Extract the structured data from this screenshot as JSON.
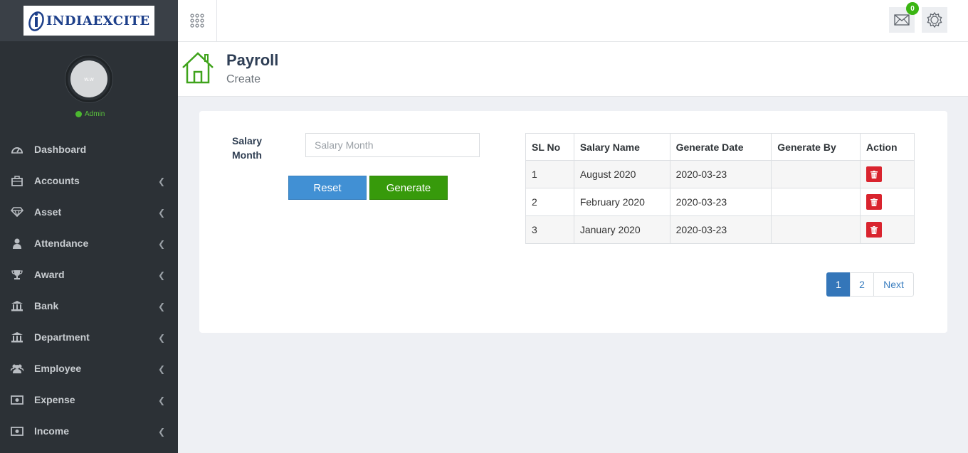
{
  "brand": {
    "name": "INDIAEXCITE"
  },
  "sidebar": {
    "avatar_text": "w.w",
    "role": "Admin",
    "items": [
      {
        "label": "Dashboard",
        "icon": "dashboard-icon",
        "has_submenu": false
      },
      {
        "label": "Accounts",
        "icon": "briefcase-icon",
        "has_submenu": true
      },
      {
        "label": "Asset",
        "icon": "diamond-icon",
        "has_submenu": true
      },
      {
        "label": "Attendance",
        "icon": "user-icon",
        "has_submenu": true
      },
      {
        "label": "Award",
        "icon": "trophy-icon",
        "has_submenu": true
      },
      {
        "label": "Bank",
        "icon": "bank-icon",
        "has_submenu": true
      },
      {
        "label": "Department",
        "icon": "building-icon",
        "has_submenu": true
      },
      {
        "label": "Employee",
        "icon": "users-icon",
        "has_submenu": true
      },
      {
        "label": "Expense",
        "icon": "money-icon",
        "has_submenu": true
      },
      {
        "label": "Income",
        "icon": "money-icon",
        "has_submenu": true
      }
    ]
  },
  "topbar": {
    "mail_count": "0"
  },
  "header": {
    "title": "Payroll",
    "subtitle": "Create"
  },
  "form": {
    "label": "Salary Month",
    "placeholder": "Salary Month",
    "value": "",
    "reset_label": "Reset",
    "generate_label": "Generate"
  },
  "table": {
    "columns": [
      "SL No",
      "Salary Name",
      "Generate Date",
      "Generate By",
      "Action"
    ],
    "rows": [
      {
        "sl": "1",
        "name": "August 2020",
        "date": "2020-03-23",
        "by": ""
      },
      {
        "sl": "2",
        "name": "February 2020",
        "date": "2020-03-23",
        "by": ""
      },
      {
        "sl": "3",
        "name": "January 2020",
        "date": "2020-03-23",
        "by": ""
      }
    ]
  },
  "pagination": {
    "pages": [
      "1",
      "2"
    ],
    "current": "1",
    "next_label": "Next"
  },
  "colors": {
    "sidebar_bg": "#2c3136",
    "reset_button": "#4190d4",
    "generate_button": "#379a0b",
    "delete_button": "#d9242e",
    "active_page": "#3476b9",
    "status_green": "#4cb830",
    "home_icon": "#3fa31b"
  }
}
